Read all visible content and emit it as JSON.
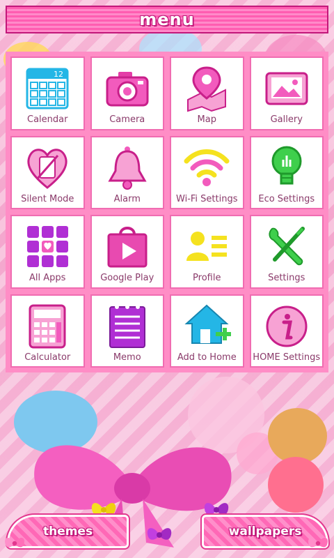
{
  "header": {
    "title": "menu"
  },
  "tiles": [
    {
      "label": "Calendar",
      "icon": "calendar-icon",
      "badge": "12"
    },
    {
      "label": "Camera",
      "icon": "camera-icon"
    },
    {
      "label": "Map",
      "icon": "map-pin-icon"
    },
    {
      "label": "Gallery",
      "icon": "gallery-icon"
    },
    {
      "label": "Silent Mode",
      "icon": "silent-mode-icon"
    },
    {
      "label": "Alarm",
      "icon": "bell-icon"
    },
    {
      "label": "Wi-Fi Settings",
      "icon": "wifi-icon"
    },
    {
      "label": "Eco Settings",
      "icon": "bulb-icon"
    },
    {
      "label": "All Apps",
      "icon": "apps-grid-icon"
    },
    {
      "label": "Google Play",
      "icon": "play-bag-icon"
    },
    {
      "label": "Profile",
      "icon": "profile-icon"
    },
    {
      "label": "Settings",
      "icon": "wrench-screwdriver-icon"
    },
    {
      "label": "Calculator",
      "icon": "calculator-icon"
    },
    {
      "label": "Memo",
      "icon": "memo-icon"
    },
    {
      "label": "Add to Home",
      "icon": "add-home-icon"
    },
    {
      "label": "HOME Settings",
      "icon": "info-icon"
    }
  ],
  "buttons": {
    "themes": "themes",
    "wallpapers": "wallpapers"
  },
  "colors": {
    "accent": "#ff5db1",
    "border": "#f06cb1",
    "label": "#8a3a6a"
  }
}
